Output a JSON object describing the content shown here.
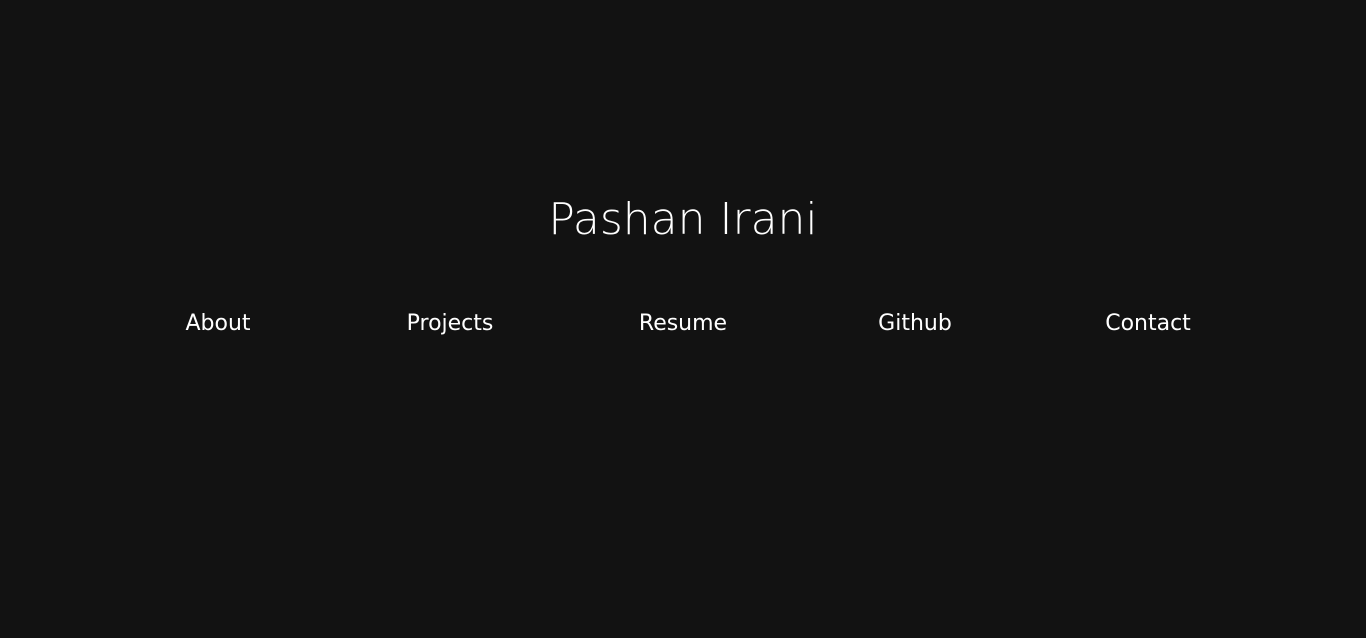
{
  "header": {
    "title": "Pashan Irani"
  },
  "nav": {
    "items": [
      {
        "label": "About"
      },
      {
        "label": "Projects"
      },
      {
        "label": "Resume"
      },
      {
        "label": "Github"
      },
      {
        "label": "Contact"
      }
    ]
  },
  "colors": {
    "background": "#121212",
    "text": "#ffffff"
  }
}
